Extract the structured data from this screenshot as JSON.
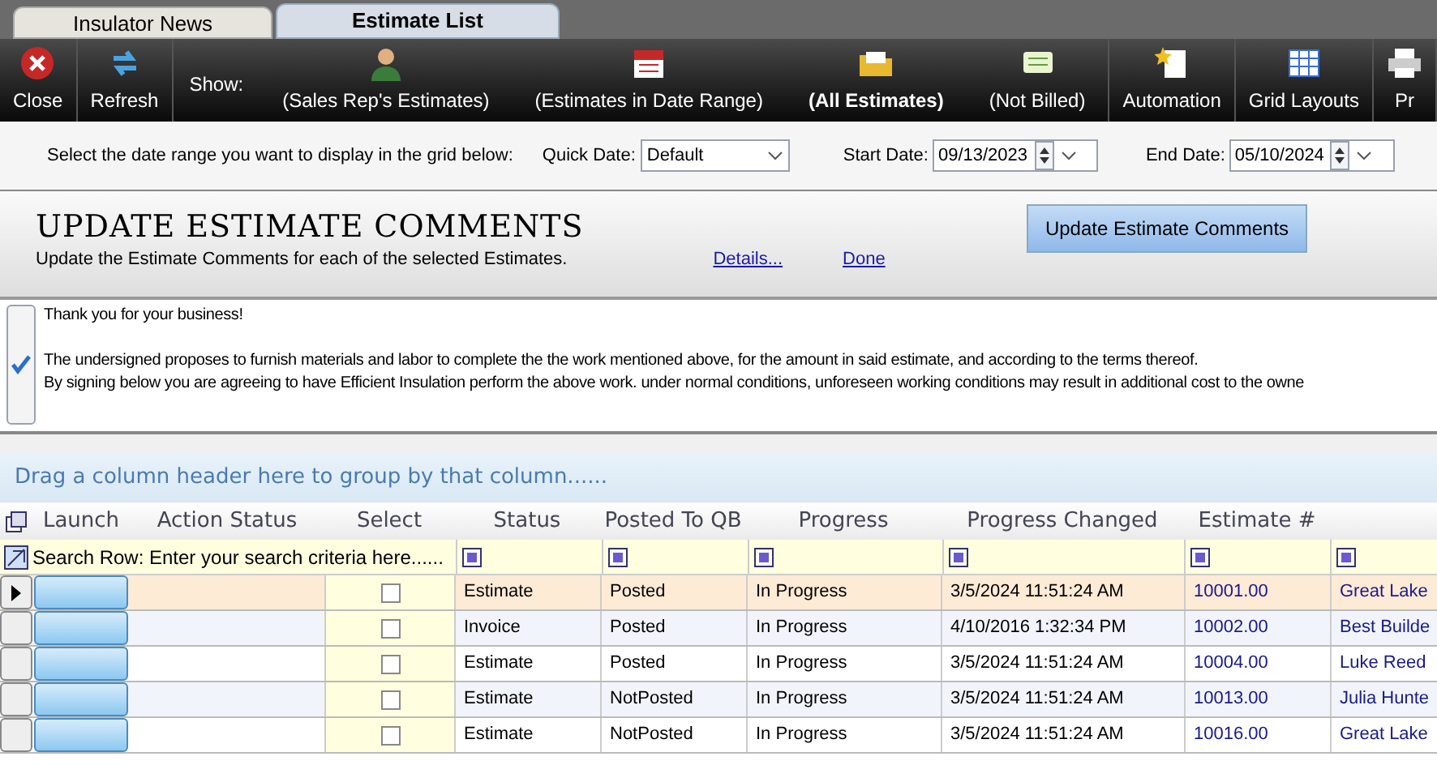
{
  "tabs": [
    {
      "label": "Insulator News",
      "selected": false
    },
    {
      "label": "Estimate List",
      "selected": true
    }
  ],
  "toolbar": [
    {
      "kind": "button",
      "label": "Close",
      "selected": false
    },
    {
      "kind": "button",
      "label": "Refresh",
      "selected": false
    },
    {
      "kind": "label",
      "label": "Show:"
    },
    {
      "kind": "filter",
      "label": "(Sales Rep's Estimates)",
      "selected": false
    },
    {
      "kind": "filter",
      "label": "(Estimates in Date Range)",
      "selected": false
    },
    {
      "kind": "filter",
      "label": "(All Estimates)",
      "selected": true
    },
    {
      "kind": "filter",
      "label": "(Not Billed)",
      "selected": false
    },
    {
      "kind": "button",
      "label": "Automation",
      "selected": false
    },
    {
      "kind": "button",
      "label": "Grid Layouts",
      "selected": false
    },
    {
      "kind": "button",
      "label": "Pr",
      "selected": false
    }
  ],
  "date_bar": {
    "prompt": "Select the date range you want to display in the grid below:",
    "quick_date_label": "Quick Date:",
    "quick_date_value": "Default",
    "start_label": "Start Date:",
    "start_value": "09/13/2023",
    "end_label": "End Date:",
    "end_value": "05/10/2024"
  },
  "comments_panel": {
    "title": "UPDATE ESTIMATE COMMENTS",
    "description": "Update the Estimate Comments for each of the selected Estimates.",
    "details_link": "Details...",
    "done_link": "Done",
    "update_button": "Update Estimate Comments",
    "checked": true,
    "greeting": "Thank you for your business!",
    "lines": [
      "The undersigned proposes to furnish materials and labor to complete the the work mentioned above, for the amount in said estimate, and according to the terms thereof.",
      "By signing below you are agreeing to have Efficient Insulation perform the above work. under normal conditions, unforeseen working conditions may result in additional cost to the owne"
    ]
  },
  "grid": {
    "group_hint": "Drag a column header here to group by that column......",
    "search_hint": "Search Row: Enter your search criteria here......",
    "columns": [
      "Launch",
      "Action Status",
      "Select",
      "Status",
      "Posted To QB",
      "Progress",
      "Progress Changed",
      "Estimate #"
    ],
    "rows": [
      {
        "selected": true,
        "checked": false,
        "status": "Estimate",
        "posted": "Posted",
        "progress": "In Progress",
        "changed": "3/5/2024 11:51:24 AM",
        "estimate": "10001.00",
        "column_10": "Great Lake"
      },
      {
        "selected": false,
        "checked": false,
        "status": "Invoice",
        "posted": "Posted",
        "progress": "In Progress",
        "changed": "4/10/2016 1:32:34 PM",
        "estimate": "10002.00",
        "column_10": "Best Builde"
      },
      {
        "selected": false,
        "checked": false,
        "status": "Estimate",
        "posted": "Posted",
        "progress": "In Progress",
        "changed": "3/5/2024 11:51:24 AM",
        "estimate": "10004.00",
        "column_10": "Luke Reed"
      },
      {
        "selected": false,
        "checked": false,
        "status": "Estimate",
        "posted": "NotPosted",
        "progress": "In Progress",
        "changed": "3/5/2024 11:51:24 AM",
        "estimate": "10013.00",
        "column_10": "Julia Hunte"
      },
      {
        "selected": false,
        "checked": false,
        "status": "Estimate",
        "posted": "NotPosted",
        "progress": "In Progress",
        "changed": "3/5/2024 11:51:24 AM",
        "estimate": "10016.00",
        "column_10": "Great Lake"
      }
    ]
  }
}
